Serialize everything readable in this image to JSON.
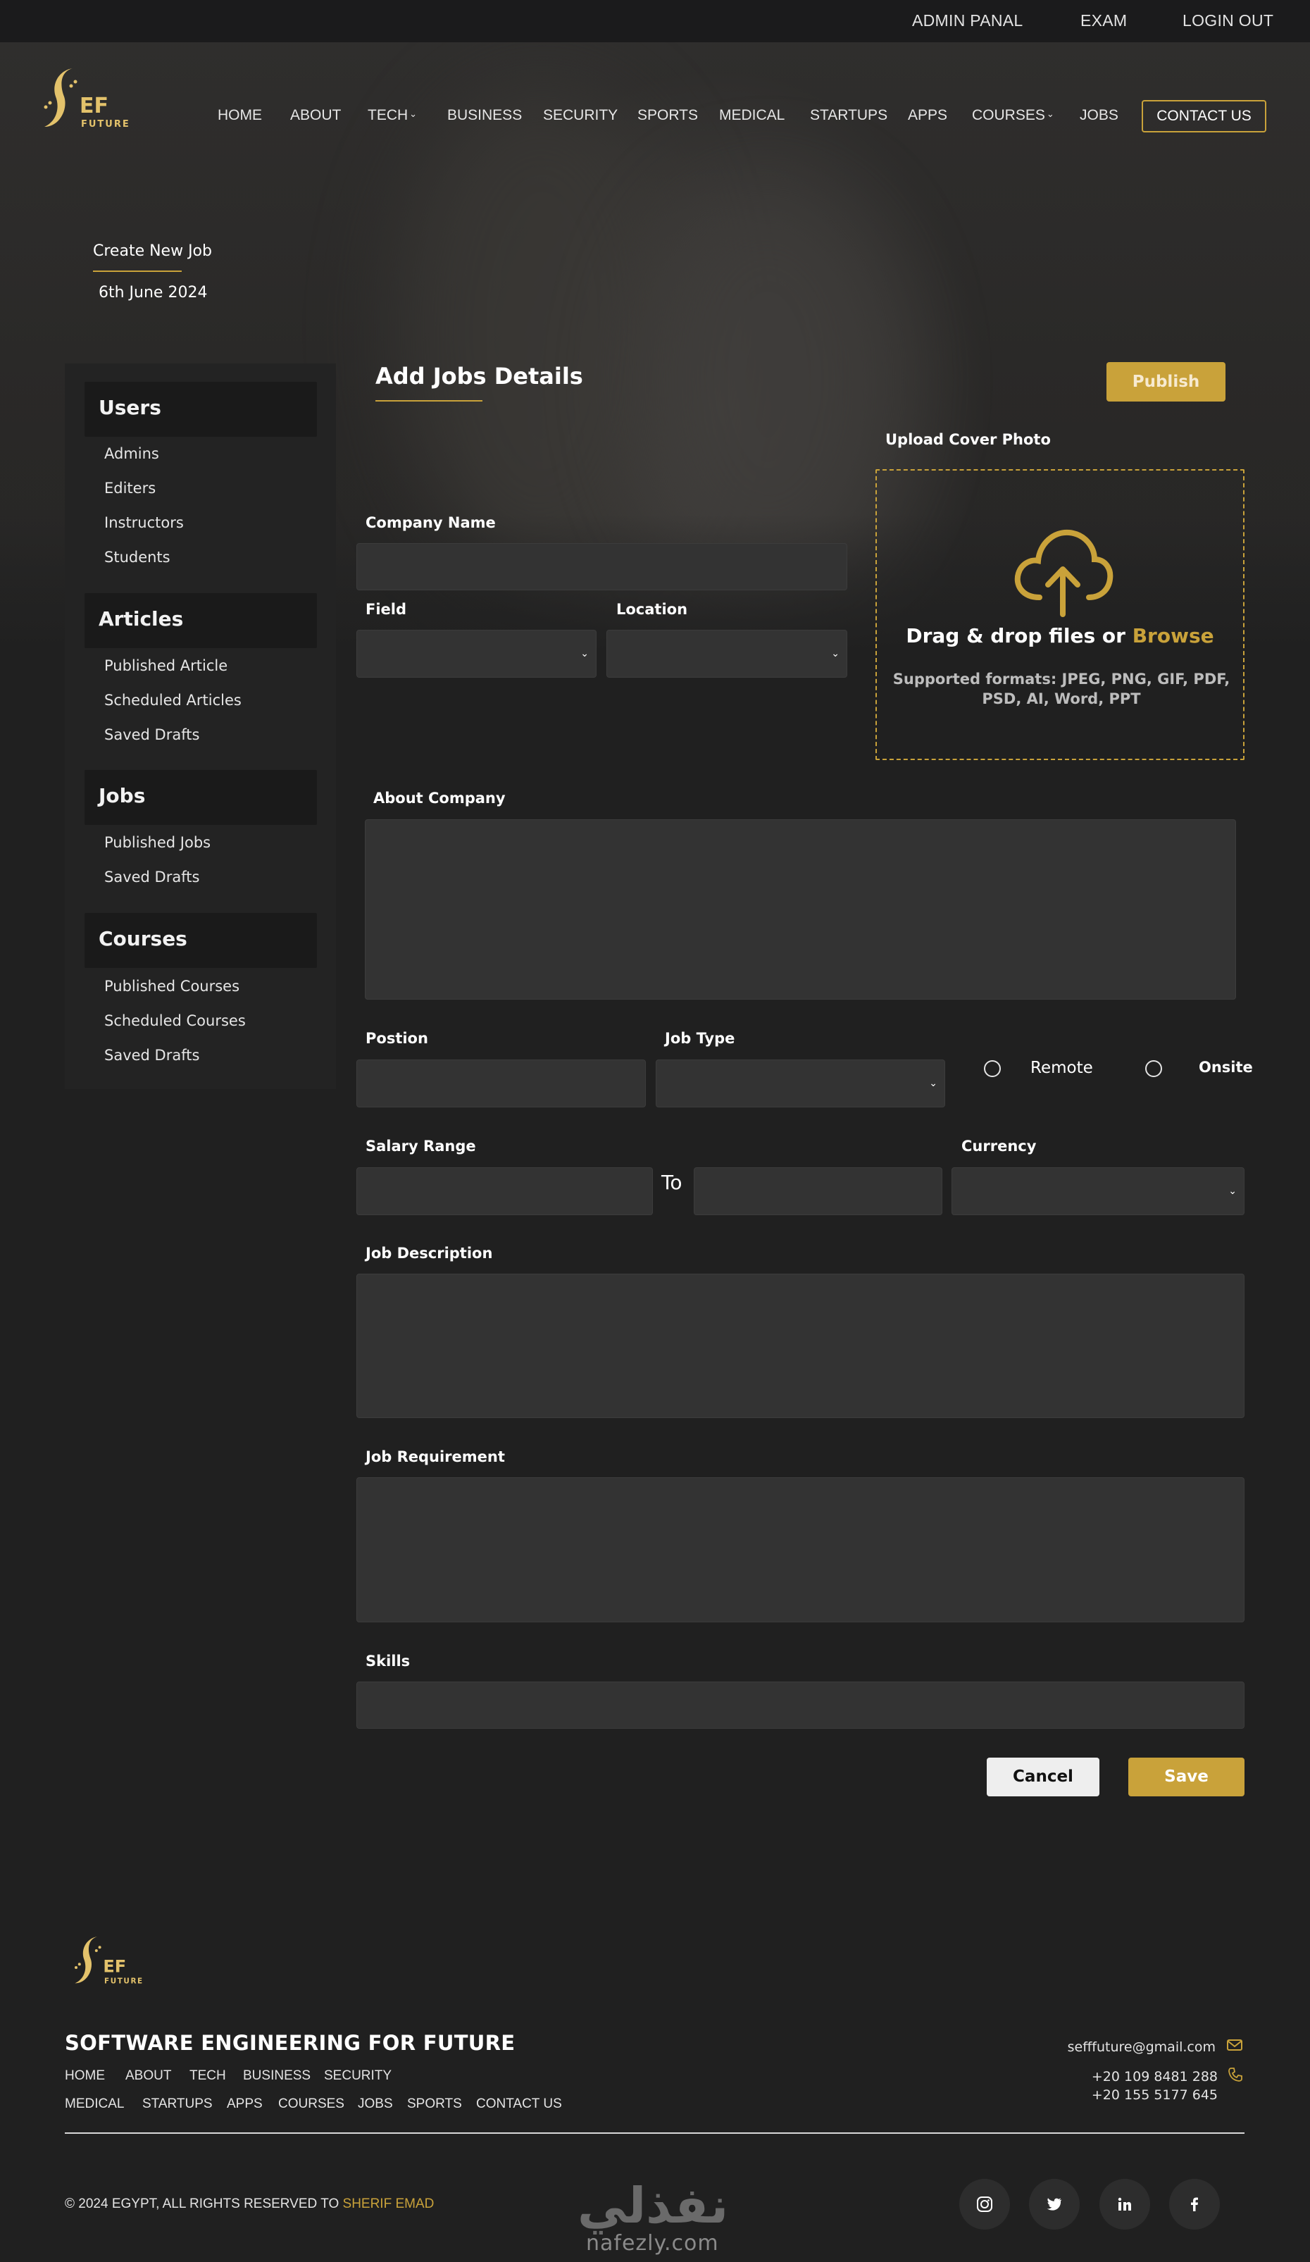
{
  "topbar": {
    "links": [
      "ADMIN PANAL",
      "EXAM",
      "LOGIN OUT"
    ]
  },
  "brand": {
    "logo_top": "EF",
    "logo_bottom": "FUTURE",
    "accent_color": "#c9a23a"
  },
  "nav": {
    "items": [
      "HOME",
      "ABOUT",
      "TECH",
      "BUSINESS",
      "SECURITY",
      "SPORTS",
      "MEDICAL",
      "STARTUPS",
      "APPS",
      "COURSES",
      "JOBS"
    ],
    "contact": "CONTACT US"
  },
  "page": {
    "title": "Create New Job",
    "date": "6th June 2024"
  },
  "sidebar": {
    "groups": [
      {
        "title": "Users",
        "items": [
          "Admins",
          "Editers",
          "Instructors",
          "Students"
        ]
      },
      {
        "title": "Articles",
        "items": [
          "Published Article",
          "Scheduled Articles",
          "Saved Drafts"
        ]
      },
      {
        "title": "Jobs",
        "items": [
          "Published Jobs",
          "Saved Drafts"
        ]
      },
      {
        "title": "Courses",
        "items": [
          "Published Courses",
          "Scheduled Courses",
          "Saved Drafts"
        ]
      }
    ]
  },
  "form": {
    "heading": "Add Jobs Details",
    "publish": "Publish",
    "company_name": "Company Name",
    "field": "Field",
    "location": "Location",
    "about_company": "About Company",
    "position": "Postion",
    "job_type": "Job Type",
    "remote": "Remote",
    "onsite": "Onsite",
    "salary_range": "Salary Range",
    "to": "To",
    "currency": "Currency",
    "job_description": "Job Description",
    "job_requirement": "Job Requirement",
    "skills": "Skills",
    "cancel": "Cancel",
    "save": "Save"
  },
  "upload": {
    "label": "Upload Cover Photo",
    "drag_text": "Drag & drop files or ",
    "browse": "Browse",
    "formats": "Supported formats: JPEG, PNG, GIF, PDF, PSD, AI, Word, PPT",
    "icon": "cloud-upload-icon"
  },
  "footer": {
    "title": "SOFTWARE ENGINEERING FOR FUTURE",
    "nav_row1": [
      "HOME",
      "ABOUT",
      "TECH",
      "BUSINESS",
      "SECURITY"
    ],
    "nav_row2": [
      "MEDICAL",
      "STARTUPS",
      "APPS",
      "COURSES",
      "JOBS",
      "SPORTS",
      "CONTACT US"
    ],
    "email": "sefffuture@gmail.com",
    "phone1": "+20 109 8481 288",
    "phone2": "+20 155 5177 645",
    "copyright": "© 2024 EGYPT, ALL RIGHTS RESERVED TO ",
    "author": "SHERIF EMAD",
    "social": [
      "instagram-icon",
      "twitter-icon",
      "linkedin-icon",
      "facebook-icon"
    ]
  },
  "watermark": {
    "arabic": "نفذلي",
    "latin": "nafezly.com"
  }
}
